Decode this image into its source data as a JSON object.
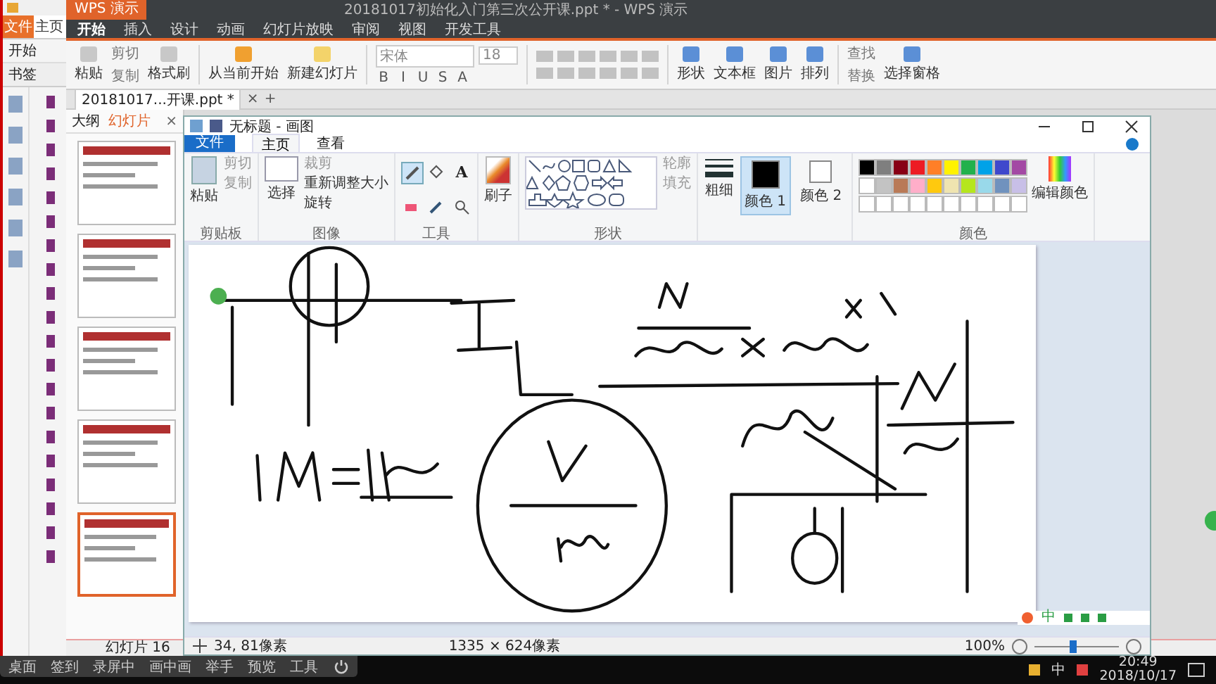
{
  "pdf_window": {
    "tabs": [
      {
        "label": "文件",
        "selected": true
      },
      {
        "label": "主页",
        "selected": false
      }
    ],
    "subtab": "开始",
    "panel_title": "书签"
  },
  "wps": {
    "app_button": "WPS 演示",
    "title": "20181017初始化入门第三次公开课.ppt * - WPS 演示",
    "menu": [
      {
        "label": "开始",
        "selected": true
      },
      {
        "label": "插入",
        "selected": false
      },
      {
        "label": "设计",
        "selected": false
      },
      {
        "label": "动画",
        "selected": false
      },
      {
        "label": "幻灯片放映",
        "selected": false
      },
      {
        "label": "审阅",
        "selected": false
      },
      {
        "label": "视图",
        "selected": false
      },
      {
        "label": "开发工具",
        "selected": false
      }
    ],
    "ribbon": {
      "paste": "粘贴",
      "cut": "剪切",
      "copy": "复制",
      "format_painter": "格式刷",
      "from_current": "从当前开始",
      "new_slide": "新建幻灯片",
      "font": "宋体",
      "font_size": "18",
      "format_buttons": [
        "B",
        "I",
        "U",
        "S",
        "A"
      ],
      "insert_buttons": [
        "形状",
        "文本框",
        "图片",
        "排列"
      ],
      "find": "查找",
      "replace": "替换",
      "selection_pane": "选择窗格"
    },
    "doc_tab": {
      "label": "20181017...开课.ppt *",
      "close": "×",
      "add": "+"
    },
    "panel_tabs": [
      {
        "label": "大纲",
        "selected": false
      },
      {
        "label": "幻灯片",
        "selected": true
      }
    ],
    "panel_close": "×",
    "thumbnails": [
      {
        "selected": false
      },
      {
        "selected": false
      },
      {
        "selected": false
      },
      {
        "selected": false
      },
      {
        "selected": true
      }
    ],
    "status": "幻灯片 16"
  },
  "paint": {
    "title": "无标题 - 画图",
    "file_tab": "文件",
    "tabs": [
      {
        "label": "主页",
        "selected": true
      },
      {
        "label": "查看",
        "selected": false
      }
    ],
    "clipboard": {
      "paste": "粘贴",
      "cut": "剪切",
      "copy": "复制",
      "label": "剪贴板"
    },
    "image": {
      "select": "选择",
      "crop": "裁剪",
      "resize": "重新调整大小",
      "rotate": "旋转",
      "label": "图像"
    },
    "tools": {
      "text_tool": "A",
      "label": "工具"
    },
    "brushes": "刷子",
    "shapes": {
      "outline": "轮廓",
      "fill": "填充",
      "label": "形状"
    },
    "size": "粗细",
    "color1": {
      "label": "颜色 1",
      "color": "#000000",
      "selected": true
    },
    "color2": {
      "label": "颜色 2",
      "color": "#ffffff",
      "selected": false
    },
    "palette": [
      {
        "color": "#000000"
      },
      {
        "color": "#7f7f7f"
      },
      {
        "color": "#880015"
      },
      {
        "color": "#ed1c24"
      },
      {
        "color": "#ff7f27"
      },
      {
        "color": "#fff200"
      },
      {
        "color": "#22b14c"
      },
      {
        "color": "#00a2e8"
      },
      {
        "color": "#3f48cc"
      },
      {
        "color": "#a349a4"
      },
      {
        "color": "#ffffff"
      },
      {
        "color": "#c3c3c3"
      },
      {
        "color": "#b97a57"
      },
      {
        "color": "#ffaec9"
      },
      {
        "color": "#ffc90e"
      },
      {
        "color": "#efe4b0"
      },
      {
        "color": "#b5e61d"
      },
      {
        "color": "#99d9ea"
      },
      {
        "color": "#7092be"
      },
      {
        "color": "#c8bfe7"
      }
    ],
    "edit_colors": "编辑颜色",
    "colors_label": "颜色",
    "status": {
      "position": "34, 81像素",
      "dimensions": "1335 × 624像素",
      "zoom": "100%",
      "zoom_slider": {
        "level": 0.45
      }
    }
  },
  "ime": {
    "mode": "中"
  },
  "recorder_bar": [
    "桌面",
    "签到",
    "录屏中",
    "画中画",
    "举手",
    "预览",
    "工具"
  ],
  "taskbar": {
    "input_mode": "中",
    "time": "20:49",
    "date": "2018/10/17"
  }
}
